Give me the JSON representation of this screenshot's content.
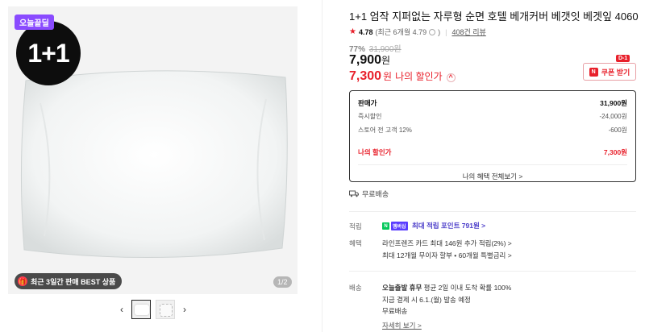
{
  "gallery": {
    "today_badge": "오늘끝딜",
    "promo_label": "1+1",
    "best_badge": "최근 3일간 판매 BEST 상품",
    "best_icon_glyph": "🎁",
    "pager": "1/2",
    "prev_arrow": "‹",
    "next_arrow": "›"
  },
  "product": {
    "title": "1+1 엄작 지퍼없는 자루형 순면 호텔 베개커버 베갯잇 베겟잎 4060",
    "rating": "4.78",
    "rating_recent": "(최근 6개월 4.79",
    "rating_recent_tail": ")",
    "reviews": "408건 리뷰",
    "discount_pct": "77%",
    "original_price": "31,900원",
    "price": "7,900",
    "price_unit": "원",
    "my_price": "7,300",
    "my_price_unit": "원",
    "my_price_label": "나의 할인가",
    "my_price_caret": "^"
  },
  "coupon": {
    "label": "쿠폰 받기",
    "icon_glyph": "N",
    "dday": "D-1"
  },
  "price_breakdown": {
    "rows": [
      {
        "label": "판매가",
        "value": "31,900원"
      },
      {
        "label": "즉시할인",
        "value": "-24,000원"
      },
      {
        "label": "스토어 전 고객 12%",
        "value": "-600원"
      }
    ],
    "my_label": "나의 할인가",
    "my_value": "7,300원",
    "all_benefits": "나의 혜택 전체보기 >"
  },
  "shipping_top": "무료배송",
  "benefits": {
    "points_label": "적립",
    "points_badge_n": "N",
    "points_badge_plus": "멤버십",
    "points_text": "최대 적립 포인트 791원 >",
    "benefit_label": "혜택",
    "benefit_line1": "라인프렌즈 카드 최대 146원 추가 적립(2%) >",
    "benefit_line2": "최대 12개월 무이자 할부 • 60개월 특별금리 >"
  },
  "delivery": {
    "label": "배송",
    "line1_strong": "오늘출발 휴무",
    "line1_rest": " 평균 2일 이내 도착 확률 100%",
    "line2": "지금 결제 시 6.1.(월) 발송 예정",
    "line3": "무료배송",
    "more": "자세히 보기 >"
  },
  "colors": {
    "accent_red": "#e8202b",
    "today_badge_purple": "#8a4bff",
    "naver_green": "#03c75a"
  }
}
